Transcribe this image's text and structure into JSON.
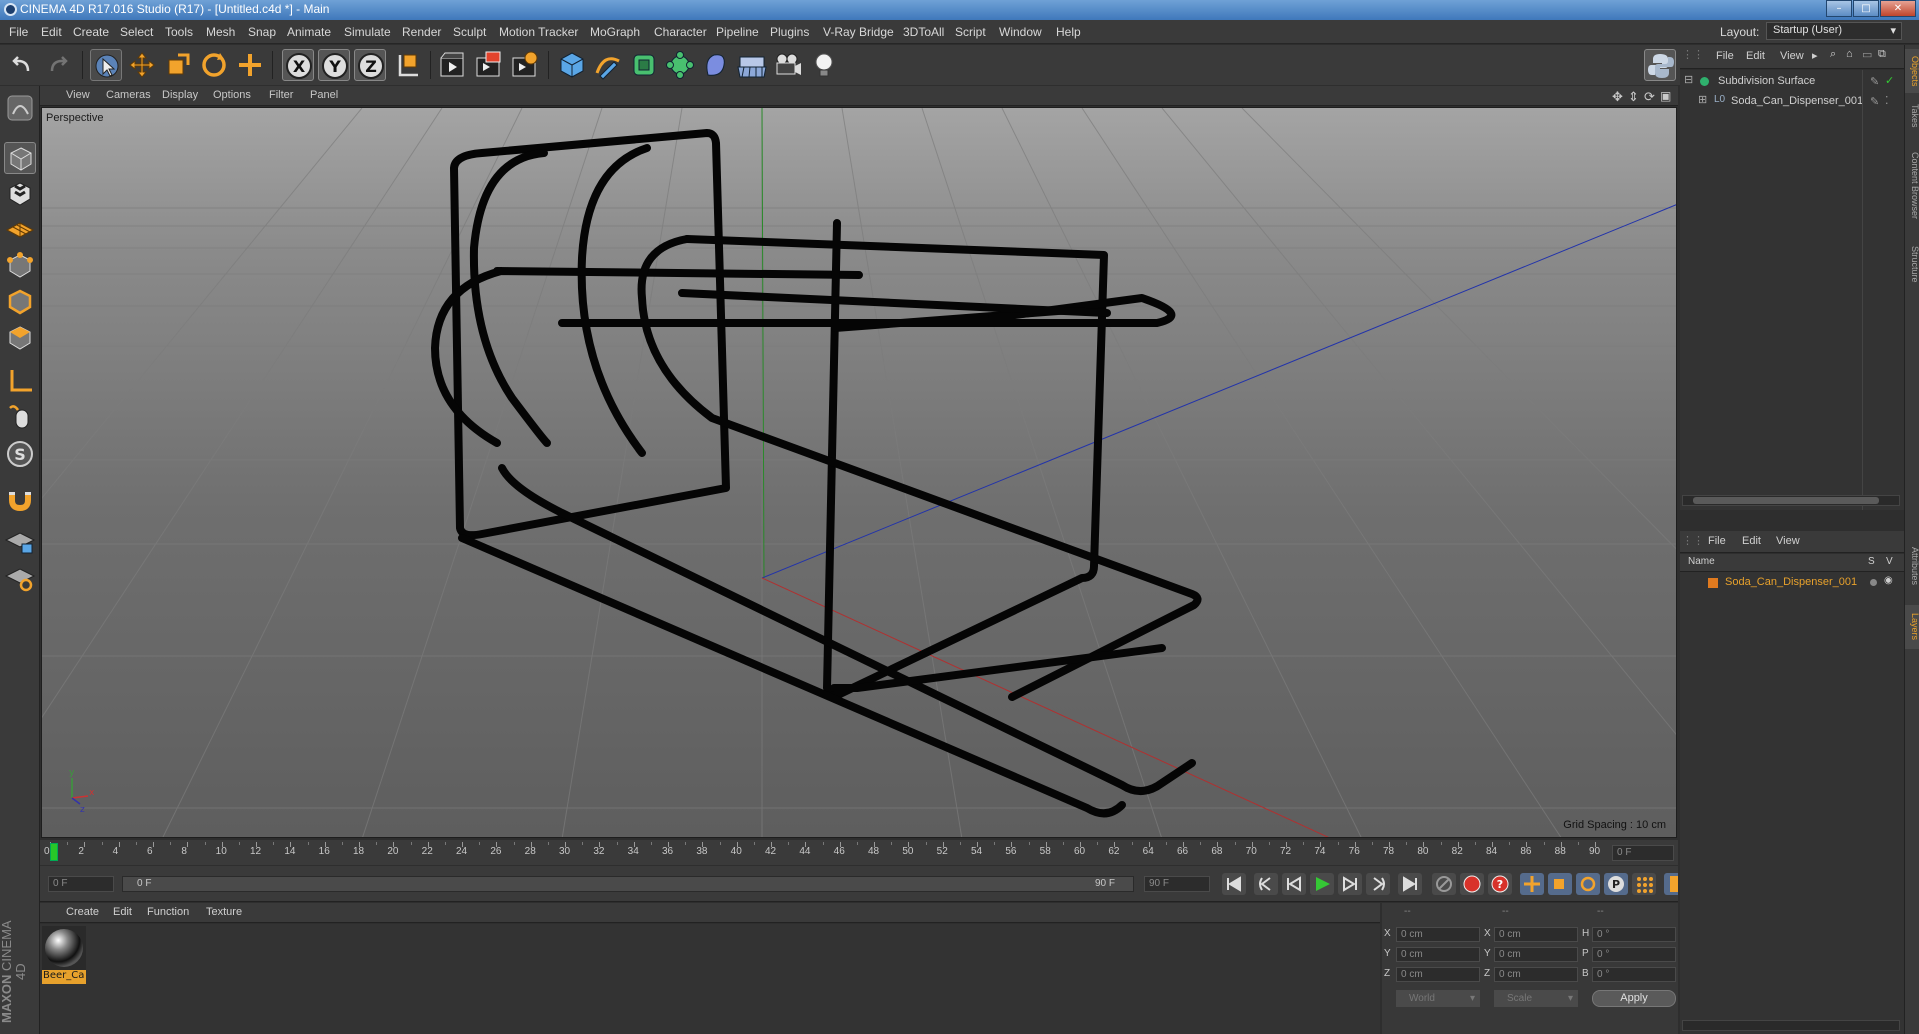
{
  "window": {
    "title": "CINEMA 4D R17.016 Studio (R17) - [Untitled.c4d *] - Main",
    "controls": [
      "–",
      "□",
      "✕"
    ]
  },
  "menubar": {
    "items": [
      "File",
      "Edit",
      "Create",
      "Select",
      "Tools",
      "Mesh",
      "Snap",
      "Animate",
      "Simulate",
      "Render",
      "Sculpt",
      "Motion Tracker",
      "MoGraph",
      "Character",
      "Pipeline",
      "Plugins",
      "V-Ray Bridge",
      "3DToAll",
      "Script",
      "Window",
      "Help"
    ],
    "layout_label": "Layout:",
    "layout_value": "Startup (User)"
  },
  "toolbar": {
    "icons": [
      "undo-icon",
      "redo-icon",
      "live-select-icon",
      "move-icon",
      "scale-icon",
      "rotate-icon",
      "last-tool-icon",
      "x-axis-icon",
      "y-axis-icon",
      "z-axis-icon",
      "world-coord-icon",
      "render-view-icon",
      "render-picture-viewer-icon",
      "render-settings-icon",
      "cube-icon",
      "pen-spline-icon",
      "subdivision-icon",
      "array-icon",
      "deformer-icon",
      "floor-icon",
      "camera-icon",
      "light-icon"
    ],
    "axis_labels": [
      "X",
      "Y",
      "Z"
    ],
    "python_icon": "python-icon"
  },
  "left_tools": {
    "icons": [
      "make-editable-icon",
      "model-mode-icon",
      "texture-mode-icon",
      "workplane-icon",
      "points-mode-icon",
      "edges-mode-icon",
      "polygons-mode-icon",
      "axis-icon",
      "tweak-icon",
      "snap-s-icon",
      "magnet-icon",
      "lock-workplane-icon",
      "workplane-snap-icon"
    ]
  },
  "viewport": {
    "menu": [
      "View",
      "Cameras",
      "Display",
      "Options",
      "Filter",
      "Panel"
    ],
    "label": "Perspective",
    "grid_spacing": "Grid Spacing : 10 cm",
    "nav_icons": [
      "move-view-icon",
      "dolly-view-icon",
      "rotate-view-icon",
      "maximize-view-icon"
    ]
  },
  "timeline": {
    "ticks": [
      "0",
      "2",
      "4",
      "6",
      "8",
      "10",
      "12",
      "14",
      "16",
      "18",
      "20",
      "22",
      "24",
      "26",
      "28",
      "30",
      "32",
      "34",
      "36",
      "38",
      "40",
      "42",
      "44",
      "46",
      "48",
      "50",
      "52",
      "54",
      "56",
      "58",
      "60",
      "62",
      "64",
      "66",
      "68",
      "70",
      "72",
      "74",
      "76",
      "78",
      "80",
      "82",
      "84",
      "86",
      "88",
      "90"
    ],
    "current_frame_field": "0 F",
    "start_field": "0 F",
    "range_start": "0 F",
    "range_end": "90 F",
    "end_field": "90 F"
  },
  "materials": {
    "menu": [
      "Create",
      "Edit",
      "Function",
      "Texture"
    ],
    "items": [
      {
        "name": "Beer_Ca"
      }
    ]
  },
  "coordinates": {
    "headers": [
      "--",
      "--",
      "--"
    ],
    "rows": [
      {
        "a": "X",
        "av": "0 cm",
        "b": "X",
        "bv": "0 cm",
        "c": "H",
        "cv": "0 °"
      },
      {
        "a": "Y",
        "av": "0 cm",
        "b": "Y",
        "bv": "0 cm",
        "c": "P",
        "cv": "0 °"
      },
      {
        "a": "Z",
        "av": "0 cm",
        "b": "Z",
        "bv": "0 cm",
        "c": "B",
        "cv": "0 °"
      }
    ],
    "mode1": "World",
    "mode2": "Scale",
    "apply": "Apply"
  },
  "objects": {
    "menu": [
      "File",
      "Edit",
      "View"
    ],
    "items": [
      {
        "name": "Subdivision Surface",
        "color": "#2fb06d"
      },
      {
        "name": "Soda_Can_Dispenser_001",
        "color": "#9ab0c8"
      }
    ]
  },
  "layers": {
    "menu": [
      "File",
      "Edit",
      "View"
    ],
    "head_name": "Name",
    "head_s": "S",
    "head_v": "V",
    "items": [
      {
        "name": "Soda_Can_Dispenser_001",
        "color": "#e07a1f"
      }
    ]
  },
  "right_tabs": [
    "Objects",
    "Takes",
    "Content Browser",
    "Structure",
    "Attributes",
    "Layers"
  ],
  "brand": {
    "line1": "MAXON",
    "line2": "CINEMA 4D"
  },
  "colors": {
    "accent": "#e7a12c",
    "panel": "#3a3a3a",
    "viewport_top": "#a4a4a4",
    "viewport_bottom": "#5e5e5e"
  }
}
